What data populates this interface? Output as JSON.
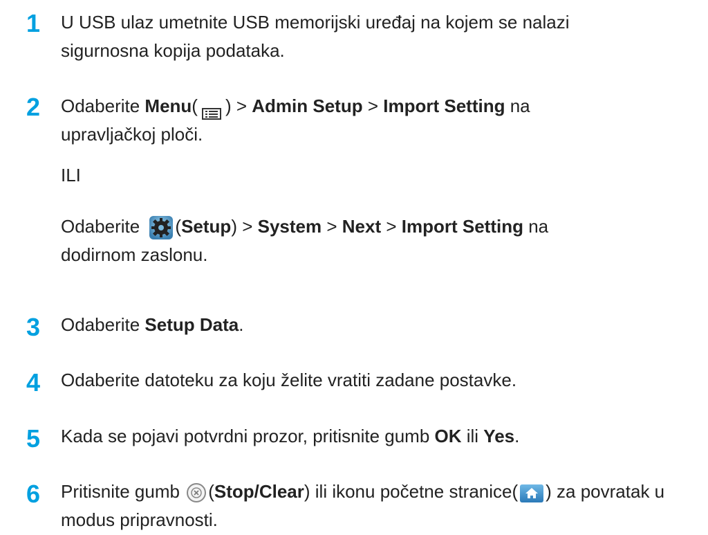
{
  "steps": [
    {
      "num": "1",
      "text": "U USB ulaz umetnite USB memorijski uređaj na kojem se nalazi sigurnosna kopija podataka."
    },
    {
      "num": "2",
      "a": "Odaberite ",
      "b": "Menu",
      "c": "(",
      "d": ") > ",
      "e": "Admin Setup",
      "f": " > ",
      "g": "Import Setting",
      "h": " na upravljačkoj ploči.",
      "ili": "ILI",
      "p2a": "Odaberite ",
      "p2b": "(",
      "p2c": "Setup",
      "p2d": ") > ",
      "p2e": "System",
      "p2f": " > ",
      "p2g": "Next",
      "p2h": " > ",
      "p2i": "Import Setting",
      "p2j": " na dodirnom zaslonu."
    },
    {
      "num": "3",
      "a": "Odaberite ",
      "b": "Setup Data",
      "c": "."
    },
    {
      "num": "4",
      "text": "Odaberite datoteku za koju želite vratiti zadane postavke."
    },
    {
      "num": "5",
      "a": "Kada se pojavi potvrdni prozor, pritisnite gumb ",
      "b": "OK",
      "c": " ili ",
      "d": "Yes",
      "e": "."
    },
    {
      "num": "6",
      "a": "Pritisnite gumb ",
      "b": "(",
      "c": "Stop/Clear",
      "d": ") ili ikonu početne stranice(",
      "e": ") za povratak u modus pripravnosti."
    }
  ],
  "icons": {
    "menu": "menu-icon",
    "setup": "gear-icon",
    "stop": "stop-clear-icon",
    "home": "home-icon"
  }
}
